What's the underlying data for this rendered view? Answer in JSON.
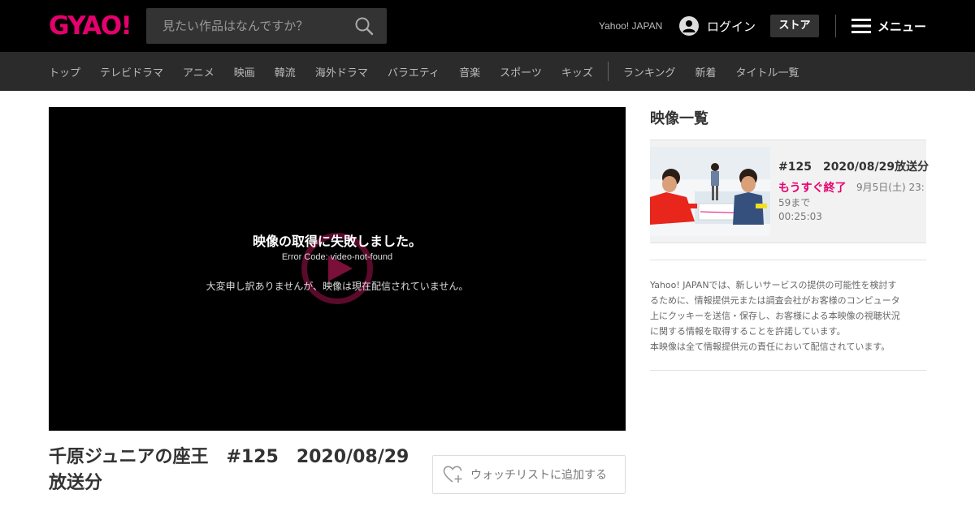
{
  "header": {
    "logo": "GYAO!",
    "search_placeholder": "見たい作品はなんですか？",
    "yahoo_link": "Yahoo! JAPAN",
    "login_label": "ログイン",
    "store_label": "ストア",
    "menu_label": "メニュー",
    "logo_color": "#e6006e"
  },
  "nav": {
    "items": [
      "トップ",
      "テレビドラマ",
      "アニメ",
      "映画",
      "韓流",
      "海外ドラマ",
      "バラエティ",
      "音楽",
      "スポーツ",
      "キッズ"
    ],
    "items_after_separator": [
      "ランキング",
      "新着",
      "タイトル一覧"
    ]
  },
  "player": {
    "error_title": "映像の取得に失敗しました。",
    "error_code": "Error Code: video-not-found",
    "error_message": "大変申し訳ありませんが、映像は現在配信されていません。"
  },
  "video": {
    "title_line1": "千原ジュニアの座王　#125　2020/08/29",
    "title_line2": "放送分",
    "watchlist_label": "ウォッチリストに追加する"
  },
  "sidebar": {
    "heading": "映像一覧",
    "episode": {
      "title": "#125　2020/08/29放送分",
      "badge": "もうすぐ終了",
      "expiry_line1": "9月5日(土) 23:",
      "expiry_line2": "59まで",
      "duration": "00:25:03"
    },
    "notice_line1": "Yahoo! JAPANでは、新しいサービスの提供の可能性を検討す",
    "notice_line2": "るために、情報提供元または調査会社がお客様のコンピュータ",
    "notice_line3": "上にクッキーを送信・保存し、お客様による本映像の視聴状況",
    "notice_line4": "に関する情報を取得することを許諾しています。",
    "notice_line5": "本映像は全て情報提供元の責任において配信されています。",
    "accent_color": "#e6006e"
  }
}
